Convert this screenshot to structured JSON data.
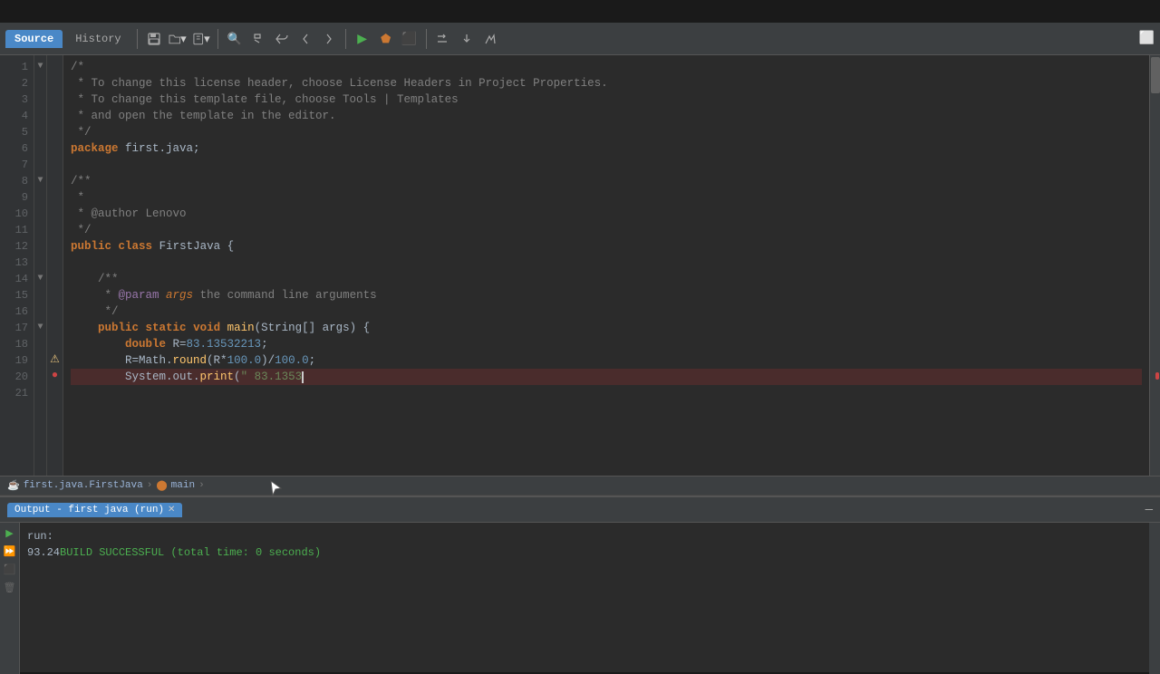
{
  "topbar": {
    "bg": "#1a1a1a"
  },
  "toolbar": {
    "tab_source": "Source",
    "tab_history": "History"
  },
  "editor": {
    "lines": [
      {
        "num": "1",
        "fold": "▼",
        "content": "/*",
        "type": "comment"
      },
      {
        "num": "2",
        "fold": " ",
        "content": " * To change this license header, choose License Headers in Project Properties.",
        "type": "comment"
      },
      {
        "num": "3",
        "fold": " ",
        "content": " * To change this template file, choose Tools | Templates",
        "type": "comment"
      },
      {
        "num": "4",
        "fold": " ",
        "content": " * and open the template in the editor.",
        "type": "comment"
      },
      {
        "num": "5",
        "fold": " ",
        "content": " */",
        "type": "comment"
      },
      {
        "num": "6",
        "fold": " ",
        "content": "package_line",
        "type": "package"
      },
      {
        "num": "7",
        "fold": " ",
        "content": "",
        "type": "blank"
      },
      {
        "num": "8",
        "fold": "▼",
        "content": "/**",
        "type": "comment"
      },
      {
        "num": "9",
        "fold": " ",
        "content": " *",
        "type": "comment"
      },
      {
        "num": "10",
        "fold": " ",
        "content": " * @author Lenovo",
        "type": "comment"
      },
      {
        "num": "11",
        "fold": " ",
        "content": " */",
        "type": "comment"
      },
      {
        "num": "12",
        "fold": " ",
        "content": "class_line",
        "type": "class"
      },
      {
        "num": "13",
        "fold": " ",
        "content": "",
        "type": "blank"
      },
      {
        "num": "14",
        "fold": "▼",
        "content": "    /**",
        "type": "comment_indent"
      },
      {
        "num": "15",
        "fold": " ",
        "content": "     * @param args the command line arguments",
        "type": "comment_indent"
      },
      {
        "num": "16",
        "fold": " ",
        "content": "     */",
        "type": "comment_indent"
      },
      {
        "num": "17",
        "fold": "▼",
        "content": "main_line",
        "type": "main"
      },
      {
        "num": "18",
        "fold": " ",
        "content": "        double R=83.13532213;",
        "type": "code"
      },
      {
        "num": "19",
        "fold": " ",
        "content": "        R=Math.round(R*100.0)/100.0;",
        "type": "code"
      },
      {
        "num": "20",
        "fold": " ",
        "content": "error_line",
        "type": "error"
      },
      {
        "num": "21",
        "fold": " ",
        "content": "",
        "type": "blank"
      }
    ]
  },
  "breadcrumb": {
    "file": "first.java.FirstJava",
    "method": "main"
  },
  "output": {
    "tab_label": "Output - first java (run)",
    "run_text": "run:",
    "build_text": "93.24BUILD SUCCESSFUL (total time: 0 seconds)"
  }
}
